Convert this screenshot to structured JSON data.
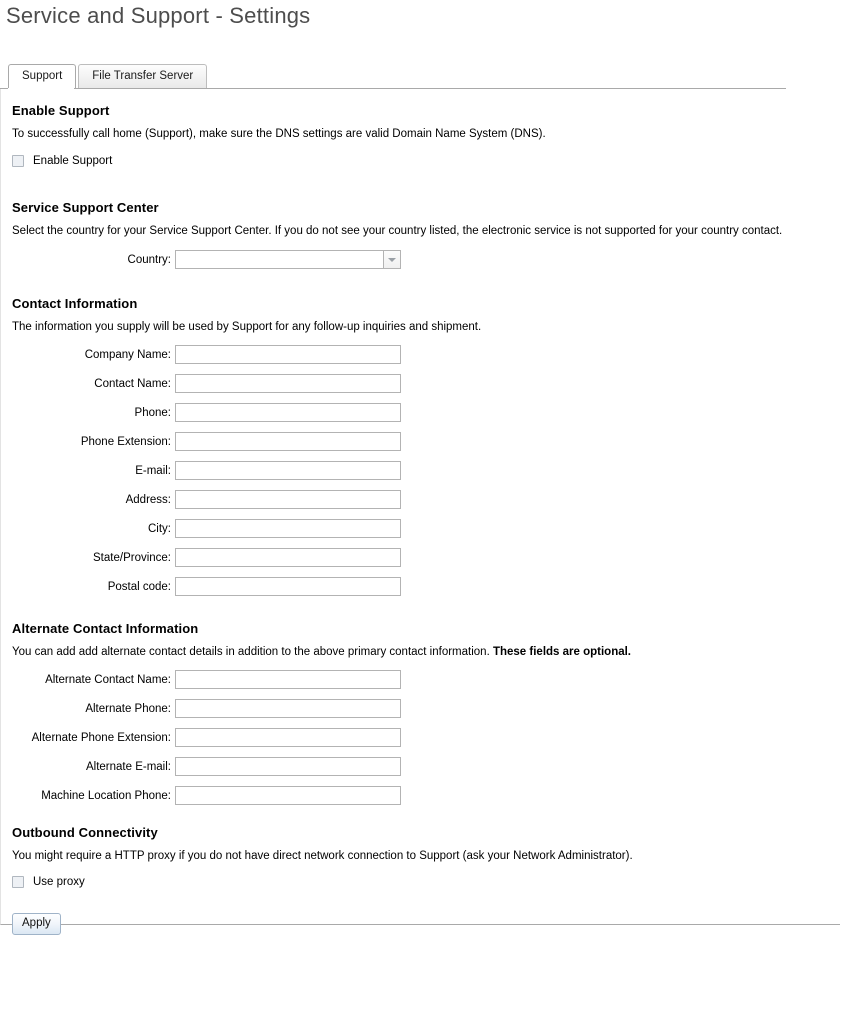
{
  "page_title": "Service and Support - Settings",
  "tabs": [
    {
      "label": "Support",
      "active": true
    },
    {
      "label": "File Transfer Server",
      "active": false
    }
  ],
  "sections": {
    "enable_support": {
      "heading": "Enable Support",
      "description": "To successfully call home (Support), make sure the DNS settings are valid Domain Name System (DNS).",
      "checkbox_label": "Enable Support",
      "checked": false
    },
    "service_support_center": {
      "heading": "Service Support Center",
      "description": "Select the country for your Service Support Center. If you do not see your country listed, the electronic service is not supported for your country contact.",
      "country_label": "Country:",
      "country_value": "",
      "country_placeholder": ""
    },
    "contact_information": {
      "heading": "Contact Information",
      "description": "The information you supply will be used by Support for any follow-up inquiries and shipment.",
      "fields": [
        {
          "label": "Company Name:",
          "value": ""
        },
        {
          "label": "Contact Name:",
          "value": ""
        },
        {
          "label": "Phone:",
          "value": ""
        },
        {
          "label": "Phone Extension:",
          "value": ""
        },
        {
          "label": "E-mail:",
          "value": ""
        },
        {
          "label": "Address:",
          "value": ""
        },
        {
          "label": "City:",
          "value": ""
        },
        {
          "label": "State/Province:",
          "value": ""
        },
        {
          "label": "Postal code:",
          "value": ""
        }
      ]
    },
    "alternate_contact_information": {
      "heading": "Alternate Contact Information",
      "description_normal": "You can add add alternate contact details in addition to the above primary contact information. ",
      "description_bold": "These fields are optional.",
      "fields": [
        {
          "label": "Alternate Contact Name:",
          "value": ""
        },
        {
          "label": "Alternate Phone:",
          "value": ""
        },
        {
          "label": "Alternate Phone Extension:",
          "value": ""
        },
        {
          "label": "Alternate E-mail:",
          "value": ""
        },
        {
          "label": "Machine Location Phone:",
          "value": ""
        }
      ]
    },
    "outbound_connectivity": {
      "heading": "Outbound Connectivity",
      "description": "You might require a HTTP proxy if you do not have direct network connection to Support (ask your Network Administrator).",
      "checkbox_label": "Use proxy",
      "checked": false
    }
  },
  "actions": {
    "apply_label": "Apply"
  },
  "colors": {
    "title_gray": "#4d4d4d",
    "panel_border": "#a9a9a9",
    "input_border": "#b3b3b3",
    "checkbox_fill": "#eef1f5",
    "button_accent": "#dbe7f3"
  }
}
